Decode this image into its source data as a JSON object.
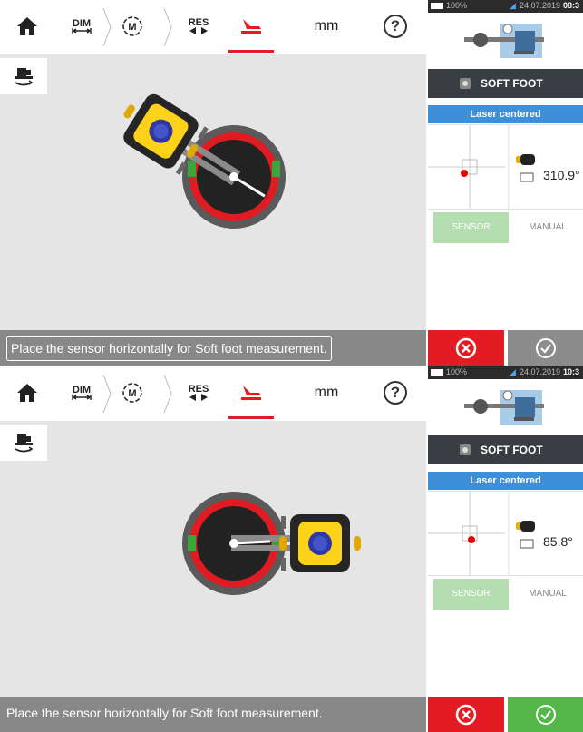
{
  "screens": [
    {
      "toolbar": {
        "dim_label": "DIM",
        "res_label": "RES",
        "unit": "mm",
        "help": "?"
      },
      "status_message": "Place the sensor horizontally for Soft foot measurement.",
      "phone_status": {
        "battery": "100%",
        "date": "24.07.2019",
        "time": "08:3"
      },
      "soft_foot_title": "SOFT FOOT",
      "laser_status": "Laser centered",
      "angle": "310.9°",
      "sensor_label": "SENSOR",
      "manual_label": "MANUAL",
      "confirm_enabled": false,
      "sensor_angle_deg": 310.9
    },
    {
      "toolbar": {
        "dim_label": "DIM",
        "res_label": "RES",
        "unit": "mm",
        "help": "?"
      },
      "status_message": "Place the sensor horizontally for Soft foot measurement.",
      "phone_status": {
        "battery": "100%",
        "date": "24.07.2019",
        "time": "10:3"
      },
      "soft_foot_title": "SOFT FOOT",
      "laser_status": "Laser centered",
      "angle": "85.8°",
      "sensor_label": "SENSOR",
      "manual_label": "MANUAL",
      "confirm_enabled": true,
      "sensor_angle_deg": 85.8
    }
  ],
  "colors": {
    "accent_red": "#e51c23",
    "laser_blue": "#3d8fd8",
    "confirm_green": "#53b848",
    "confirm_disabled": "#8c8c8c",
    "sensor_disabled": "#b5deb0"
  }
}
